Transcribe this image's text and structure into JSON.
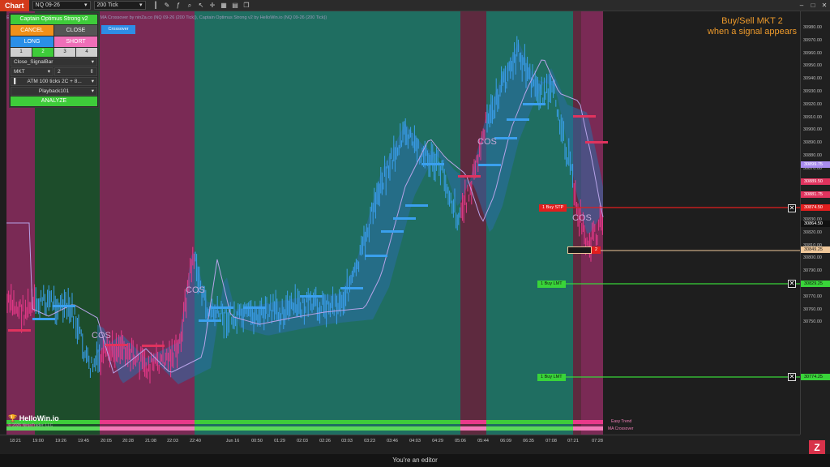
{
  "toolbar": {
    "chart_tab": "Chart",
    "instrument": "NQ 09-26",
    "interval": "200 Tick"
  },
  "indicator_title": "Easy Trend by ninZa.co (NQ 09-26 (200 Tick)), MA Crossover by ninZa.co (NQ 09-26 (200 Tick)), Captain Optimus Strong v2 by HelloWin.io (NQ 09-26 (200 Tick))",
  "crossover_button": "Crossover",
  "cta": {
    "line1": "Buy/Sell MKT 2",
    "line2": "when a signal appears"
  },
  "panel": {
    "title": "Captain Optimus Strong v2",
    "cancel": "CANCEL",
    "close": "CLOSE",
    "long": "LONG",
    "short": "SHORT",
    "numbers": [
      "1",
      "2",
      "3",
      "4"
    ],
    "signal_select": "Close_SignalBar",
    "order_type": "MKT",
    "quantity": "2",
    "atm": "ATM 100 ticks 2C + 8...",
    "account": "Playback101",
    "analyze": "ANALYZE"
  },
  "price_ticks": [
    "30980.00",
    "30970.00",
    "30960.00",
    "30950.00",
    "30940.00",
    "30930.00",
    "30920.00",
    "30910.00",
    "30900.00",
    "30890.00",
    "30880.00",
    "30870.00",
    "30860.00",
    "30850.00",
    "30840.00",
    "30830.00",
    "30820.00",
    "30810.00",
    "30800.00",
    "30790.00",
    "30780.00",
    "30770.00",
    "30760.00",
    "30750.00"
  ],
  "price_labels": [
    {
      "text": "30899.75",
      "color": "#a98cf0",
      "fg": "#fff"
    },
    {
      "text": "30889.50",
      "color": "#e0335e",
      "fg": "#fff"
    },
    {
      "text": "30881.75",
      "color": "#e0335e",
      "fg": "#fff"
    },
    {
      "text": "30874.50",
      "color": "#e31e1e",
      "fg": "#fff"
    },
    {
      "text": "30864.50",
      "color": "#111111",
      "fg": "#fff"
    },
    {
      "text": "30849.25",
      "color": "#f0c89a",
      "fg": "#222"
    },
    {
      "text": "30829.25",
      "color": "#39d439",
      "fg": "#111"
    },
    {
      "text": "30774.25",
      "color": "#39d439",
      "fg": "#111"
    }
  ],
  "orders": {
    "buy_stp": "1  Buy STP",
    "buy_lmt_1": "1  Buy LMT",
    "buy_lmt_2": "1  Buy LMT",
    "position_qty": "2"
  },
  "signals": [
    "COS",
    "COS",
    "COS",
    "COS"
  ],
  "time_labels": [
    "18:21",
    "19:00",
    "19:26",
    "19:45",
    "20:05",
    "20:28",
    "21:08",
    "22:03",
    "22:40",
    "Jun 16",
    "00:50",
    "01:29",
    "02:03",
    "02:26",
    "03:03",
    "03:23",
    "03:46",
    "04:03",
    "04:29",
    "05:06",
    "05:44",
    "06:09",
    "06:35",
    "07:08",
    "07:21",
    "07:28"
  ],
  "strip_labels": {
    "easy_trend": "Easy Trend",
    "ma_crossover": "MA Crossover"
  },
  "brand": {
    "name": "HelloWin.io",
    "copyright": "© 2026 NinjaTrader, LLC"
  },
  "footer_note": "You're an editor",
  "colors": {
    "bull_band": "#1f6e61",
    "bear_band": "#8a2d5c",
    "bull_candle": "#3aa0ee",
    "bear_candle": "#e9398a",
    "cloud": "#2a6ea8"
  }
}
